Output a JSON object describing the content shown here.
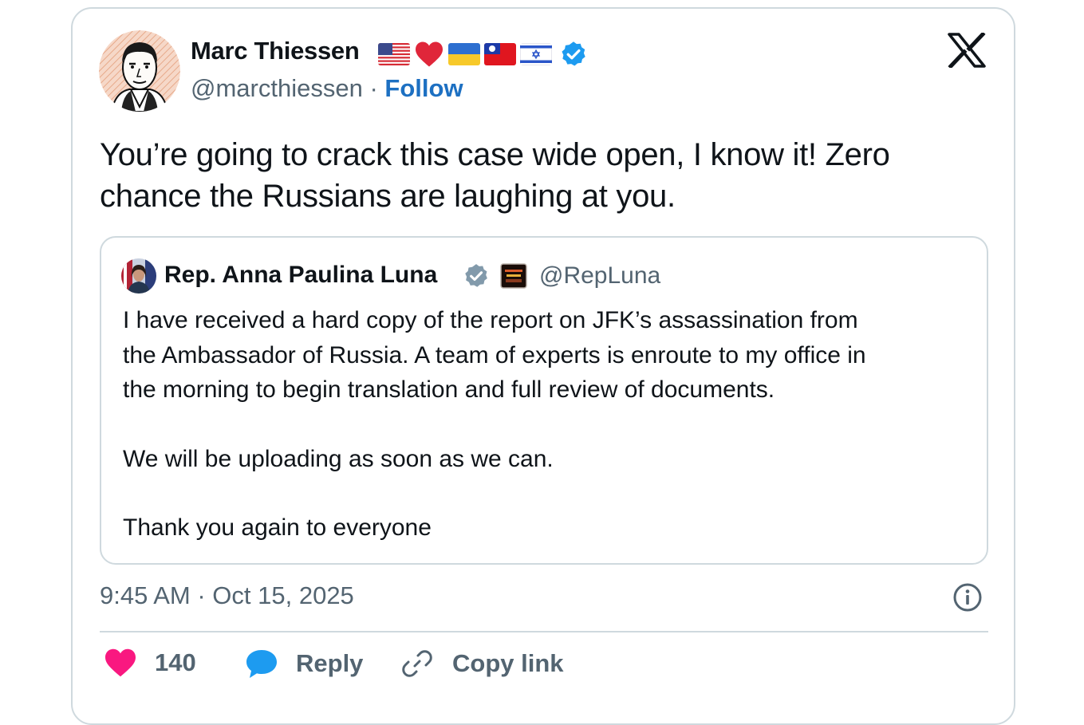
{
  "tweet": {
    "author": {
      "name": "Marc Thiessen",
      "handle": "@marcthiessen",
      "separator": "·",
      "follow_label": "Follow",
      "flags": [
        "us-flag",
        "red-heart",
        "ukraine-flag",
        "taiwan-flag",
        "israel-flag"
      ],
      "verified_color": "#1d9bf0"
    },
    "text_lines": [
      "You’re going to crack this case wide open, I know it! Zero",
      "chance the Russians are laughing at you."
    ],
    "quote": {
      "name": "Rep. Anna Paulina Luna",
      "handle": "@RepLuna",
      "verified_color": "#829aab",
      "paragraphs": [
        [
          "I have received a hard copy of the report on JFK’s assassination from",
          "the Ambassador of Russia. A team of experts is enroute to my office in",
          "the morning to begin translation and full review of documents."
        ],
        [
          "We will be uploading as soon as we can."
        ],
        [
          "Thank you again to everyone"
        ]
      ]
    },
    "timestamp": "9:45 AM · Oct 15, 2025",
    "actions": {
      "like_count": "140",
      "reply_label": "Reply",
      "copy_link_label": "Copy link"
    },
    "colors": {
      "like": "#f91880",
      "reply": "#1d9bf0",
      "link_blue": "#1d70c2",
      "muted": "#536471",
      "border": "#cfd9de"
    }
  }
}
